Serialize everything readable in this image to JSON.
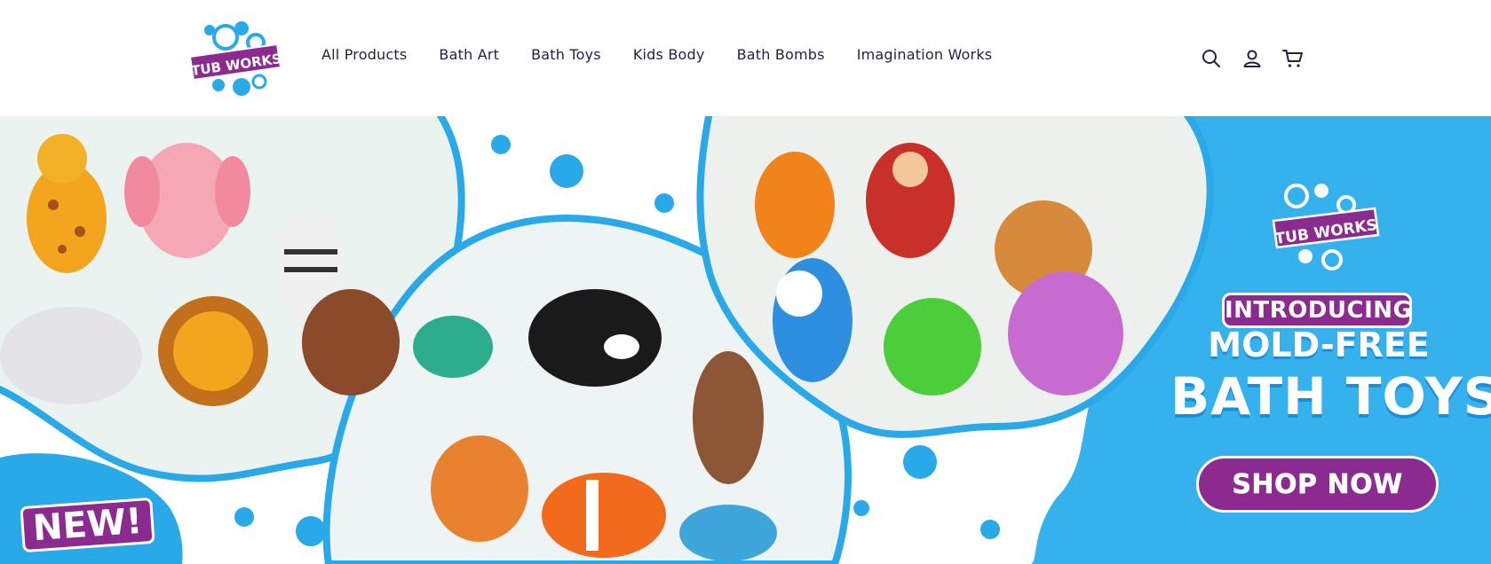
{
  "brand": {
    "name": "TUB WORKS",
    "primary_color": "#29a9e8",
    "accent_color": "#8c2b8f"
  },
  "nav": {
    "items": [
      {
        "label": "All Products"
      },
      {
        "label": "Bath Art"
      },
      {
        "label": "Bath Toys"
      },
      {
        "label": "Kids Body"
      },
      {
        "label": "Bath Bombs"
      },
      {
        "label": "Imagination Works"
      }
    ]
  },
  "header_icons": [
    "search-icon",
    "account-icon",
    "cart-icon"
  ],
  "banner": {
    "badge": "NEW!",
    "headline_1": "INTRODUCING",
    "headline_2": "MOLD-FREE",
    "headline_3": "BATH TOYS",
    "cta_label": "SHOP NOW"
  }
}
